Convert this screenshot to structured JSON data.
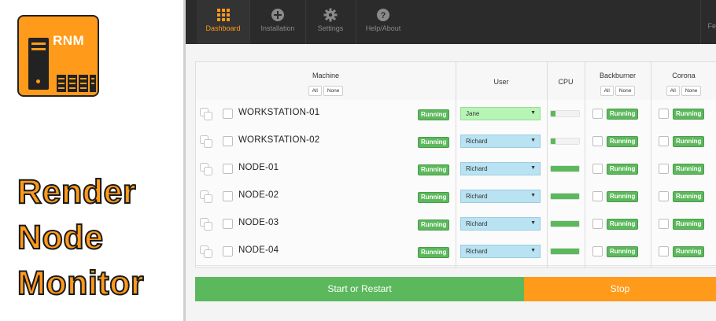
{
  "brand": {
    "logo_text": "RNM",
    "title_lines": [
      "Render",
      "Node",
      "Monitor"
    ]
  },
  "nav": {
    "items": [
      {
        "label": "Dashboard",
        "icon": "grid-icon",
        "active": true
      },
      {
        "label": "Installation",
        "icon": "plus-circle-icon",
        "active": false
      },
      {
        "label": "Settings",
        "icon": "gear-icon",
        "active": false
      },
      {
        "label": "Help/About",
        "icon": "question-circle-icon",
        "active": false
      }
    ],
    "truncated_label": "Fe"
  },
  "table": {
    "headers": {
      "machine": "Machine",
      "user": "User",
      "cpu": "CPU",
      "backburner": "Backburner",
      "corona": "Corona"
    },
    "all_label": "All",
    "none_label": "None",
    "rows": [
      {
        "machine": "WORKSTATION-01",
        "status": "Running",
        "user": "Jane",
        "cpu_percent": 18,
        "backburner": "Running",
        "corona": "Running"
      },
      {
        "machine": "WORKSTATION-02",
        "status": "Running",
        "user": "Richard",
        "cpu_percent": 18,
        "backburner": "Running",
        "corona": "Running"
      },
      {
        "machine": "NODE-01",
        "status": "Running",
        "user": "Richard",
        "cpu_percent": 100,
        "backburner": "Running",
        "corona": "Running"
      },
      {
        "machine": "NODE-02",
        "status": "Running",
        "user": "Richard",
        "cpu_percent": 100,
        "backburner": "Running",
        "corona": "Running"
      },
      {
        "machine": "NODE-03",
        "status": "Running",
        "user": "Richard",
        "cpu_percent": 100,
        "backburner": "Running",
        "corona": "Running"
      },
      {
        "machine": "NODE-04",
        "status": "Running",
        "user": "Richard",
        "cpu_percent": 100,
        "backburner": "Running",
        "corona": "Running"
      }
    ]
  },
  "actions": {
    "start_label": "Start or Restart",
    "stop_label": "Stop"
  },
  "colors": {
    "accent_orange": "#ff9a1a",
    "running_green": "#5cb85c",
    "user_highlight": "#b7f5b7",
    "user_default": "#b9e3f2",
    "topbar": "#2b2b2b"
  }
}
